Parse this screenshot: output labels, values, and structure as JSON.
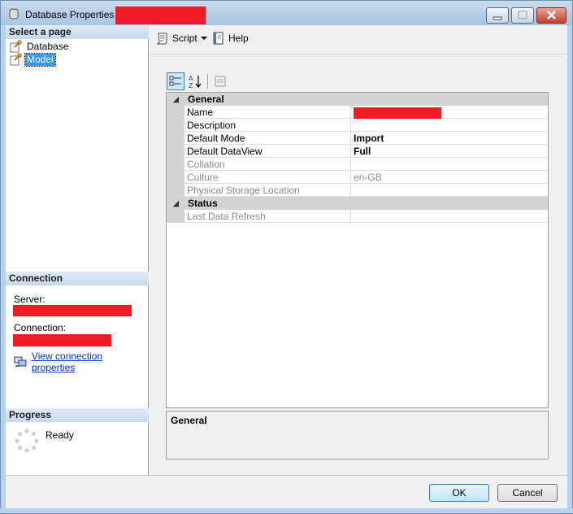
{
  "window": {
    "title": "Database Properties -"
  },
  "left_panel": {
    "select_page_header": "Select a page",
    "pages": [
      {
        "label": "Database",
        "icon": "wrench-page-icon",
        "selected": false
      },
      {
        "label": "Model",
        "icon": "wrench-page-icon",
        "selected": true
      }
    ],
    "connection_header": "Connection",
    "server_label": "Server:",
    "connection_label": "Connection:",
    "view_connection_link": "View connection properties",
    "progress_header": "Progress",
    "progress_status": "Ready"
  },
  "toolbar": {
    "script_label": "Script",
    "help_label": "Help"
  },
  "property_grid": {
    "categories": [
      {
        "label": "General",
        "rows": [
          {
            "name": "Name",
            "value": "",
            "redacted": true,
            "disabled": false,
            "bold": false
          },
          {
            "name": "Description",
            "value": "",
            "redacted": false,
            "disabled": false,
            "bold": false
          },
          {
            "name": "Default Mode",
            "value": "Import",
            "redacted": false,
            "disabled": false,
            "bold": true
          },
          {
            "name": "Default DataView",
            "value": "Full",
            "redacted": false,
            "disabled": false,
            "bold": true
          },
          {
            "name": "Collation",
            "value": "",
            "redacted": false,
            "disabled": true,
            "bold": false
          },
          {
            "name": "Culture",
            "value": "en-GB",
            "redacted": false,
            "disabled": true,
            "bold": false
          },
          {
            "name": "Physical Storage Location",
            "value": "",
            "redacted": false,
            "disabled": true,
            "bold": false
          }
        ]
      },
      {
        "label": "Status",
        "rows": [
          {
            "name": "Last Data Refresh",
            "value": "",
            "redacted": false,
            "disabled": true,
            "bold": false
          }
        ]
      }
    ],
    "description_title": "General"
  },
  "buttons": {
    "ok_label": "OK",
    "cancel_label": "Cancel"
  },
  "colors": {
    "redaction": "#ed1c24",
    "selection": "#3399ff",
    "link": "#0033cc"
  }
}
